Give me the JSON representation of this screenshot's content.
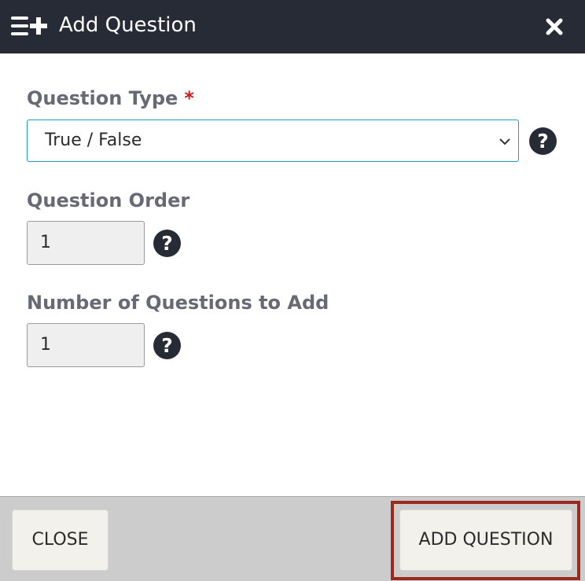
{
  "dialog": {
    "title": "Add Question",
    "header_icon": "list-plus-icon",
    "close_icon": "close-icon"
  },
  "fields": {
    "question_type": {
      "label": "Question Type",
      "required_marker": "*",
      "value": "True / False",
      "help_glyph": "?"
    },
    "question_order": {
      "label": "Question Order",
      "value": "1",
      "help_glyph": "?"
    },
    "number_to_add": {
      "label": "Number of Questions to Add",
      "value": "1",
      "help_glyph": "?"
    }
  },
  "footer": {
    "close_label": "CLOSE",
    "add_label": "ADD QUESTION"
  },
  "colors": {
    "header_bg": "#262b36",
    "select_border": "#1a9fc5",
    "required": "#c81b1b",
    "highlight": "#9a2a1e",
    "footer_bg": "#cccccc"
  }
}
